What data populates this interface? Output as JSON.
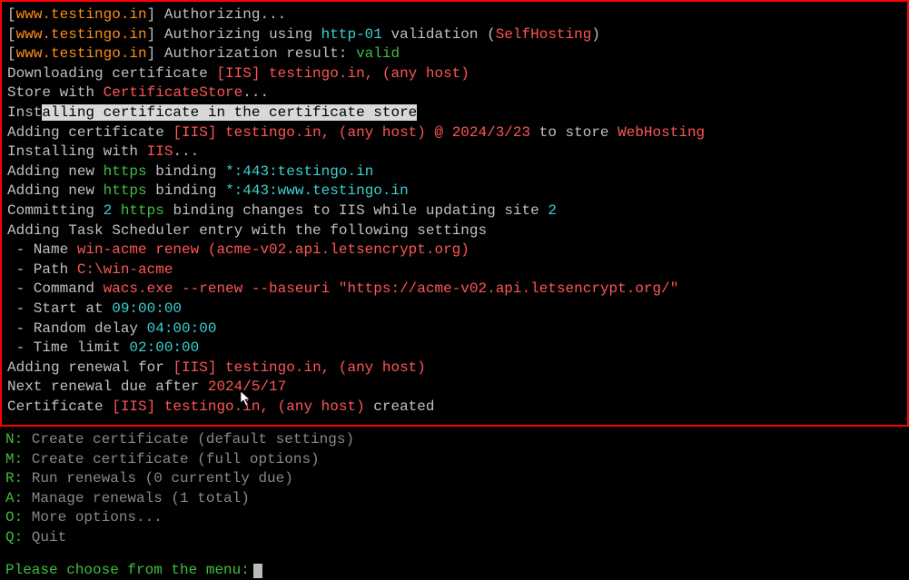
{
  "frame": {
    "lines": [
      [
        {
          "t": "[",
          "c": "grey"
        },
        {
          "t": "www.testingo.in",
          "c": "host"
        },
        {
          "t": "] ",
          "c": "grey"
        },
        {
          "t": "Authorizing...",
          "c": "grey"
        }
      ],
      [
        {
          "t": "[",
          "c": "grey"
        },
        {
          "t": "www.testingo.in",
          "c": "host"
        },
        {
          "t": "] ",
          "c": "grey"
        },
        {
          "t": "Authorizing using ",
          "c": "grey"
        },
        {
          "t": "http-01",
          "c": "cyan"
        },
        {
          "t": " validation (",
          "c": "grey"
        },
        {
          "t": "SelfHosting",
          "c": "red"
        },
        {
          "t": ")",
          "c": "grey"
        }
      ],
      [
        {
          "t": "[",
          "c": "grey"
        },
        {
          "t": "www.testingo.in",
          "c": "host"
        },
        {
          "t": "] ",
          "c": "grey"
        },
        {
          "t": "Authorization result: ",
          "c": "grey"
        },
        {
          "t": "valid",
          "c": "green"
        }
      ],
      [
        {
          "t": "Downloading certificate ",
          "c": "grey"
        },
        {
          "t": "[IIS] testingo.in, (any host)",
          "c": "red"
        }
      ],
      [
        {
          "t": "Store with ",
          "c": "grey"
        },
        {
          "t": "CertificateStore",
          "c": "red"
        },
        {
          "t": "...",
          "c": "grey"
        }
      ],
      [
        {
          "t": "Inst",
          "c": "grey"
        },
        {
          "t": "alling certificate in the certificate store",
          "c": "selected"
        }
      ],
      [
        {
          "t": "Adding certificate ",
          "c": "grey"
        },
        {
          "t": "[IIS] testingo.in, (any host) @ 2024/3/23",
          "c": "red"
        },
        {
          "t": " to store ",
          "c": "grey"
        },
        {
          "t": "WebHosting",
          "c": "red"
        }
      ],
      [
        {
          "t": "Installing with ",
          "c": "grey"
        },
        {
          "t": "IIS",
          "c": "red"
        },
        {
          "t": "...",
          "c": "grey"
        }
      ],
      [
        {
          "t": "Adding new ",
          "c": "grey"
        },
        {
          "t": "https",
          "c": "green"
        },
        {
          "t": " binding ",
          "c": "grey"
        },
        {
          "t": "*:443:testingo.in",
          "c": "cyan"
        }
      ],
      [
        {
          "t": "Adding new ",
          "c": "grey"
        },
        {
          "t": "https",
          "c": "green"
        },
        {
          "t": " binding ",
          "c": "grey"
        },
        {
          "t": "*:443:www.testingo.in",
          "c": "cyan"
        }
      ],
      [
        {
          "t": "Committing ",
          "c": "grey"
        },
        {
          "t": "2",
          "c": "cyan"
        },
        {
          "t": " ",
          "c": "grey"
        },
        {
          "t": "https",
          "c": "green"
        },
        {
          "t": " binding changes to IIS while updating site ",
          "c": "grey"
        },
        {
          "t": "2",
          "c": "cyan"
        }
      ],
      [
        {
          "t": "Adding Task Scheduler entry with the following settings",
          "c": "grey"
        }
      ],
      [
        {
          "t": " - Name ",
          "c": "grey"
        },
        {
          "t": "win-acme renew (acme-v02.api.letsencrypt.org)",
          "c": "red"
        }
      ],
      [
        {
          "t": " - Path ",
          "c": "grey"
        },
        {
          "t": "C:\\win-acme",
          "c": "red"
        }
      ],
      [
        {
          "t": " - Command ",
          "c": "grey"
        },
        {
          "t": "wacs.exe --renew --baseuri \"https://acme-v02.api.letsencrypt.org/\"",
          "c": "red"
        }
      ],
      [
        {
          "t": " - Start at ",
          "c": "grey"
        },
        {
          "t": "09:00:00",
          "c": "cyan"
        }
      ],
      [
        {
          "t": " - Random delay ",
          "c": "grey"
        },
        {
          "t": "04:00:00",
          "c": "cyan"
        }
      ],
      [
        {
          "t": " - Time limit ",
          "c": "grey"
        },
        {
          "t": "02:00:00",
          "c": "cyan"
        }
      ],
      [
        {
          "t": "Adding renewal for ",
          "c": "grey"
        },
        {
          "t": "[IIS] testingo.in, (any host)",
          "c": "red"
        }
      ],
      [
        {
          "t": "Next renewal due after ",
          "c": "grey"
        },
        {
          "t": "2024/5/17",
          "c": "red"
        }
      ],
      [
        {
          "t": "Certificate ",
          "c": "grey"
        },
        {
          "t": "[IIS] testingo.in, (any host)",
          "c": "red"
        },
        {
          "t": " created",
          "c": "grey"
        }
      ]
    ]
  },
  "menu": [
    {
      "key": "N",
      "label": "Create certificate (default settings)"
    },
    {
      "key": "M",
      "label": "Create certificate (full options)"
    },
    {
      "key": "R",
      "label": "Run renewals (0 currently due)"
    },
    {
      "key": "A",
      "label": "Manage renewals (1 total)"
    },
    {
      "key": "O",
      "label": "More options..."
    },
    {
      "key": "Q",
      "label": "Quit"
    }
  ],
  "prompt": "Please choose from the menu:"
}
